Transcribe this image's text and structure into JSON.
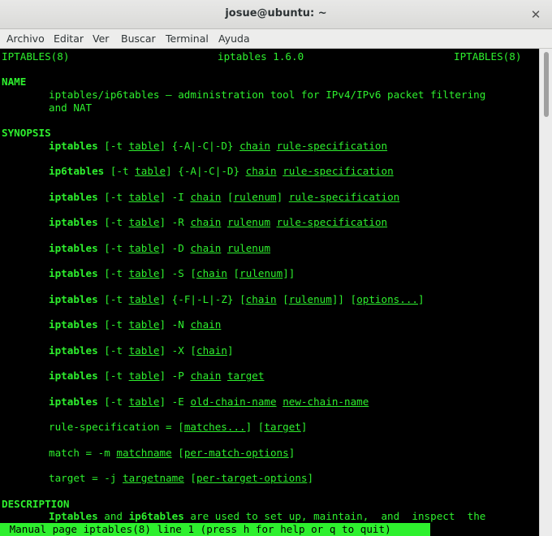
{
  "window": {
    "title": "josue@ubuntu: ~",
    "close_glyph": "✕"
  },
  "menu": [
    "Archivo",
    "Editar",
    "Ver",
    "Buscar",
    "Terminal",
    "Ayuda"
  ],
  "terminal": {
    "header_left": "IPTABLES(8)",
    "header_center": "iptables 1.6.0",
    "header_right": "IPTABLES(8)",
    "name_heading": "NAME",
    "name_line1": "iptables/ip6tables — administration tool for IPv4/IPv6 packet filtering",
    "name_line2": "and NAT",
    "synopsis_heading": "SYNOPSIS",
    "synopsis": [
      [
        [
          "b",
          "iptables"
        ],
        [
          "n",
          " [-t "
        ],
        [
          "u",
          "table"
        ],
        [
          "n",
          "] {-A|-C|-D} "
        ],
        [
          "u",
          "chain"
        ],
        [
          "n",
          " "
        ],
        [
          "u",
          "rule-specification"
        ]
      ],
      [
        [
          "b",
          "ip6tables"
        ],
        [
          "n",
          " [-t "
        ],
        [
          "u",
          "table"
        ],
        [
          "n",
          "] {-A|-C|-D} "
        ],
        [
          "u",
          "chain"
        ],
        [
          "n",
          " "
        ],
        [
          "u",
          "rule-specification"
        ]
      ],
      [
        [
          "b",
          "iptables"
        ],
        [
          "n",
          " [-t "
        ],
        [
          "u",
          "table"
        ],
        [
          "n",
          "] -I "
        ],
        [
          "u",
          "chain"
        ],
        [
          "n",
          " ["
        ],
        [
          "u",
          "rulenum"
        ],
        [
          "n",
          "] "
        ],
        [
          "u",
          "rule-specification"
        ]
      ],
      [
        [
          "b",
          "iptables"
        ],
        [
          "n",
          " [-t "
        ],
        [
          "u",
          "table"
        ],
        [
          "n",
          "] -R "
        ],
        [
          "u",
          "chain"
        ],
        [
          "n",
          " "
        ],
        [
          "u",
          "rulenum"
        ],
        [
          "n",
          " "
        ],
        [
          "u",
          "rule-specification"
        ]
      ],
      [
        [
          "b",
          "iptables"
        ],
        [
          "n",
          " [-t "
        ],
        [
          "u",
          "table"
        ],
        [
          "n",
          "] -D "
        ],
        [
          "u",
          "chain"
        ],
        [
          "n",
          " "
        ],
        [
          "u",
          "rulenum"
        ]
      ],
      [
        [
          "b",
          "iptables"
        ],
        [
          "n",
          " [-t "
        ],
        [
          "u",
          "table"
        ],
        [
          "n",
          "] -S ["
        ],
        [
          "u",
          "chain"
        ],
        [
          "n",
          " ["
        ],
        [
          "u",
          "rulenum"
        ],
        [
          "n",
          "]]"
        ]
      ],
      [
        [
          "b",
          "iptables"
        ],
        [
          "n",
          " [-t "
        ],
        [
          "u",
          "table"
        ],
        [
          "n",
          "] {-F|-L|-Z} ["
        ],
        [
          "u",
          "chain"
        ],
        [
          "n",
          " ["
        ],
        [
          "u",
          "rulenum"
        ],
        [
          "n",
          "]] ["
        ],
        [
          "u",
          "options..."
        ],
        [
          "n",
          "]"
        ]
      ],
      [
        [
          "b",
          "iptables"
        ],
        [
          "n",
          " [-t "
        ],
        [
          "u",
          "table"
        ],
        [
          "n",
          "] -N "
        ],
        [
          "u",
          "chain"
        ]
      ],
      [
        [
          "b",
          "iptables"
        ],
        [
          "n",
          " [-t "
        ],
        [
          "u",
          "table"
        ],
        [
          "n",
          "] -X ["
        ],
        [
          "u",
          "chain"
        ],
        [
          "n",
          "]"
        ]
      ],
      [
        [
          "b",
          "iptables"
        ],
        [
          "n",
          " [-t "
        ],
        [
          "u",
          "table"
        ],
        [
          "n",
          "] -P "
        ],
        [
          "u",
          "chain"
        ],
        [
          "n",
          " "
        ],
        [
          "u",
          "target"
        ]
      ],
      [
        [
          "b",
          "iptables"
        ],
        [
          "n",
          " [-t "
        ],
        [
          "u",
          "table"
        ],
        [
          "n",
          "] -E "
        ],
        [
          "u",
          "old-chain-name"
        ],
        [
          "n",
          " "
        ],
        [
          "u",
          "new-chain-name"
        ]
      ],
      [
        [
          "n",
          "rule-specification = ["
        ],
        [
          "u",
          "matches..."
        ],
        [
          "n",
          "] ["
        ],
        [
          "u",
          "target"
        ],
        [
          "n",
          "]"
        ]
      ],
      [
        [
          "n",
          "match = -m "
        ],
        [
          "u",
          "matchname"
        ],
        [
          "n",
          " ["
        ],
        [
          "u",
          "per-match-options"
        ],
        [
          "n",
          "]"
        ]
      ],
      [
        [
          "n",
          "target = -j "
        ],
        [
          "u",
          "targetname"
        ],
        [
          "n",
          " ["
        ],
        [
          "u",
          "per-target-options"
        ],
        [
          "n",
          "]"
        ]
      ]
    ],
    "description_heading": "DESCRIPTION",
    "description_line": [
      [
        "b",
        "Iptables"
      ],
      [
        "n",
        " and "
      ],
      [
        "b",
        "ip6tables"
      ],
      [
        "n",
        " are used to set up, maintain,  and  inspect  the"
      ]
    ],
    "status": " Manual page iptables(8) line 1 (press h for help or q to quit)"
  },
  "colors": {
    "terminal_fg": "#2ef02e",
    "terminal_bg": "#000000"
  }
}
